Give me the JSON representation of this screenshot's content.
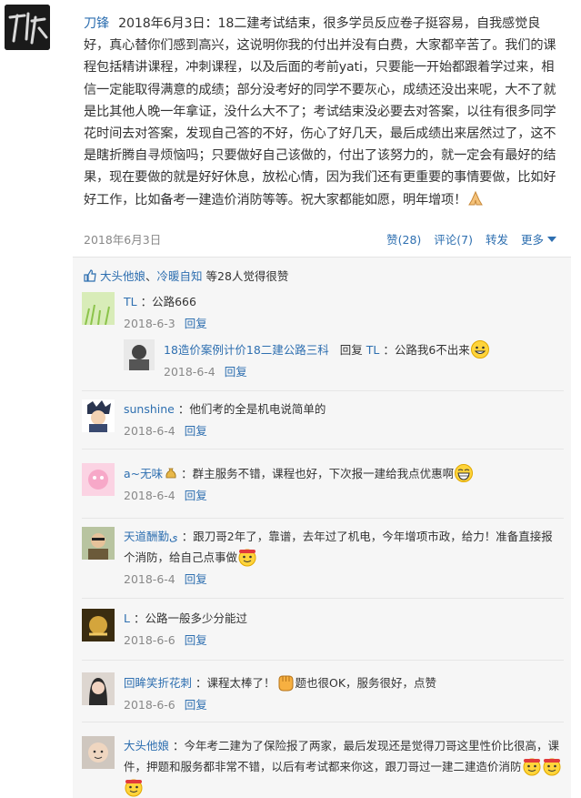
{
  "post": {
    "author": "刀锋",
    "text": "2018年6月3日：18二建考试结束，很多学员反应卷子挺容易，自我感觉良好，真心替你们感到高兴，这说明你我的付出并没有白费，大家都辛苦了。我们的课程包括精讲课程，冲刺课程，以及后面的考前yati，只要能一开始都跟着学过来，相信一定能取得满意的成绩；部分没考好的同学不要灰心，成绩还没出来呢，大不了就是比其他人晚一年拿证，没什么大不了；考试结束没必要去对答案，以往有很多同学花时间去对答案，发现自己答的不好，伤心了好几天，最后成绩出来居然过了，这不是瞎折腾自寻烦恼吗；只要做好自己该做的，付出了该努力的，就一定会有最好的结果，现在要做的就是好好休息，放松心情，因为我们还有更重要的事情要做，比如好好工作，比如备考一建造价消防等等。祝大家都能如愿，明年增项！",
    "date": "2018年6月3日",
    "actions": {
      "like": "赞(28)",
      "comment": "评论(7)",
      "share": "转发",
      "more": "更多"
    }
  },
  "likes": {
    "user1": "大头他娘",
    "sep": "、",
    "user2": "冷暖自知",
    "rest": "等28人觉得很赞"
  },
  "reply_label": "回复",
  "comments": [
    {
      "user": "TL",
      "text": "：公路666",
      "date": "2018-6-3"
    },
    {
      "user": "18造价案例计价18二建公路三科",
      "reply_to": "TL",
      "reply_word": "回复",
      "text": "：公路我6不出来",
      "date": "2018-6-4"
    },
    {
      "user": "sunshine",
      "text": "：他们考的全是机电说简单的",
      "date": "2018-6-4"
    },
    {
      "user": "a~无味",
      "text": "：群主服务不错，课程也好，下次报一建给我点优惠啊",
      "date": "2018-6-4"
    },
    {
      "user": "天道酬勤ى",
      "text": "：跟刀哥2年了，靠谱，去年过了机电，今年增项市政，给力！准备直接报个消防，给自己点事做",
      "date": "2018-6-4"
    },
    {
      "user": "L",
      "text": "：公路一般多少分能过",
      "date": "2018-6-6"
    },
    {
      "user": "回眸笑折花刺",
      "text1": "：课程太棒了！",
      "text2": "题也很OK，服务很好，点赞",
      "date": "2018-6-6"
    },
    {
      "user": "大头他娘",
      "text": "：今年考二建为了保险报了两家，最后发现还是觉得刀哥这里性价比很高，课件，押题和服务都非常不错，以后有考试都来你这，跟刀哥过一建二建造价消防"
    }
  ]
}
